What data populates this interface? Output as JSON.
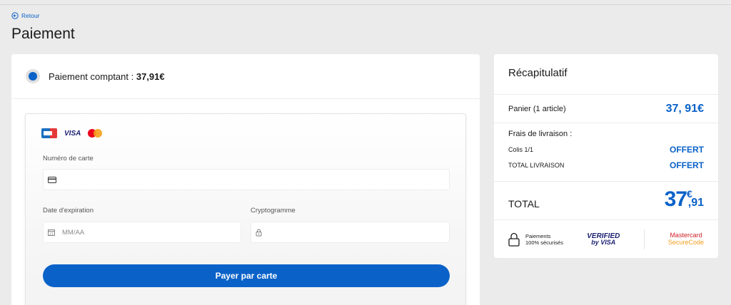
{
  "header": {
    "back_label": "Retour",
    "title": "Paiement"
  },
  "payment_option": {
    "label": "Paiement comptant : ",
    "amount": "37,91€"
  },
  "card_form": {
    "card_number_label": "Numéro de carte",
    "card_number_value": "",
    "expiry_label": "Date d'expiration",
    "expiry_placeholder": "MM/AA",
    "cvv_label": "Cryptogramme",
    "cvv_value": "",
    "pay_button": "Payer par carte",
    "logos": [
      "cb-logo",
      "visa-logo",
      "mastercard-logo"
    ]
  },
  "summary": {
    "title": "Récapitulatif",
    "cart_label": "Panier (1 article)",
    "cart_amount": "37, 91€",
    "shipping_label": "Frais de livraison :",
    "parcel_label": "Colis 1/1",
    "parcel_value": "OFFERT",
    "shipping_total_label": "TOTAL LIVRAISON",
    "shipping_total_value": "OFFERT",
    "total_label": "TOTAL",
    "total_int": "37",
    "total_currency": "€",
    "total_cents": ",91",
    "secure_line1": "Paiements",
    "secure_line2": "100% sécurisés",
    "vbv_line1": "VERIFIED",
    "vbv_line2": "by VISA",
    "msc_line1": "Mastercard",
    "msc_line2": "SecureCode"
  },
  "colors": {
    "accent": "#0a62c8",
    "background": "#ebebeb"
  }
}
